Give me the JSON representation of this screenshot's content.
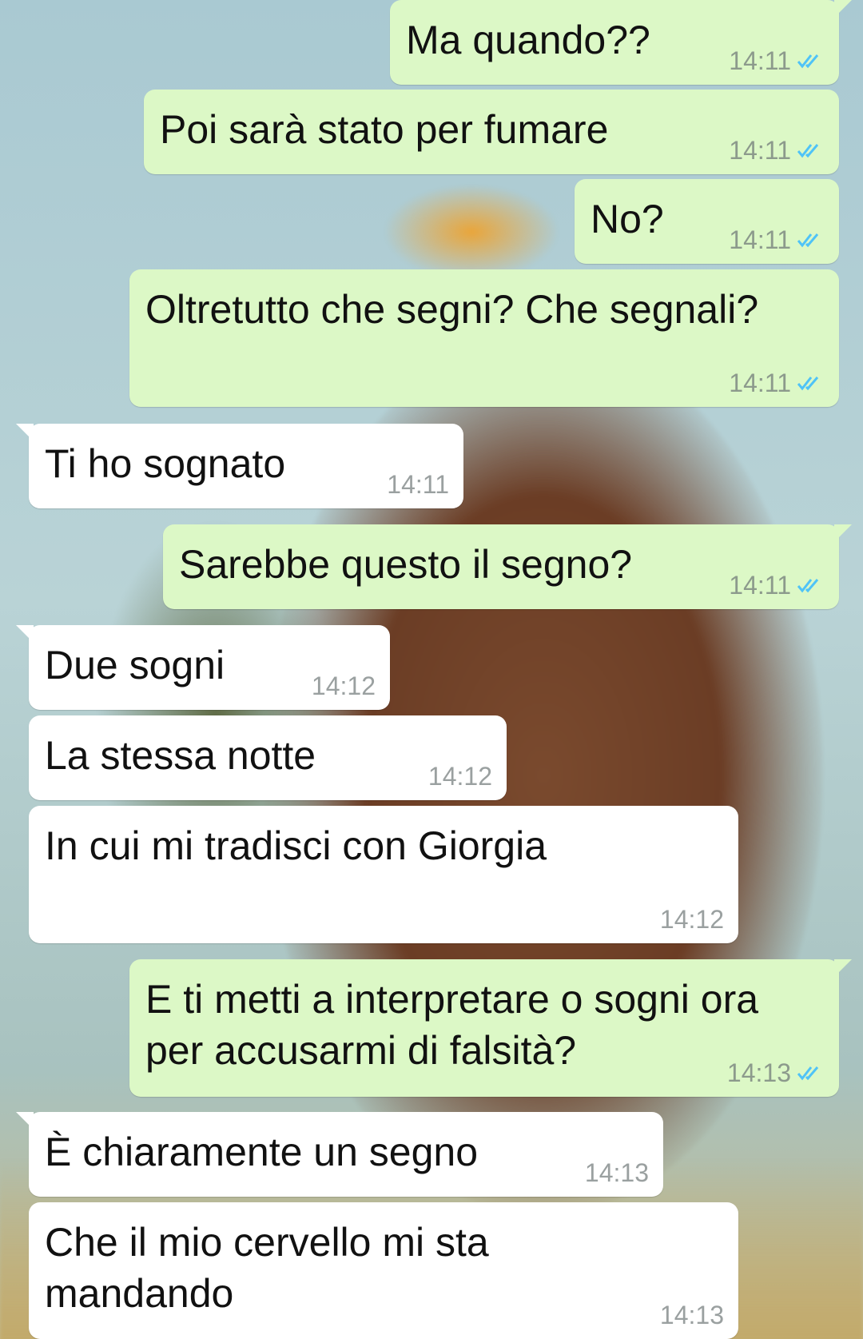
{
  "colors": {
    "outgoing_bubble": "#dcf8c6",
    "incoming_bubble": "#ffffff",
    "read_tick": "#4fc3f7",
    "timestamp": "#8c9a8c"
  },
  "messages": [
    {
      "direction": "out",
      "text": "Ma quando??",
      "time": "14:11",
      "status_icon": "double-check-read-icon"
    },
    {
      "direction": "out",
      "text": "Poi sarà stato per fumare",
      "time": "14:11",
      "status_icon": "double-check-read-icon"
    },
    {
      "direction": "out",
      "text": "No?",
      "time": "14:11",
      "status_icon": "double-check-read-icon"
    },
    {
      "direction": "out",
      "text": "Oltretutto che segni? Che segnali?",
      "time": "14:11",
      "status_icon": "double-check-read-icon"
    },
    {
      "direction": "in",
      "text": "Ti ho sognato",
      "time": "14:11"
    },
    {
      "direction": "out",
      "text": "Sarebbe questo il segno?",
      "time": "14:11",
      "status_icon": "double-check-read-icon"
    },
    {
      "direction": "in",
      "text": "Due sogni",
      "time": "14:12"
    },
    {
      "direction": "in",
      "text": "La stessa notte",
      "time": "14:12"
    },
    {
      "direction": "in",
      "text": "In cui mi tradisci con Giorgia",
      "time": "14:12"
    },
    {
      "direction": "out",
      "text": "E ti metti a interpretare o sogni ora\nper accusarmi di falsità?",
      "time": "14:13",
      "status_icon": "double-check-read-icon"
    },
    {
      "direction": "in",
      "text": "È chiaramente un segno",
      "time": "14:13"
    },
    {
      "direction": "in",
      "text": "Che il mio cervello mi sta\nmandando",
      "time": "14:13"
    }
  ]
}
